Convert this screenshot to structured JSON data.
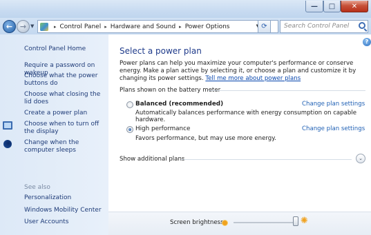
{
  "window": {
    "minimize_label": "—",
    "maximize_label": "□",
    "close_label": "✕"
  },
  "nav": {
    "back_label": "←",
    "forward_label": "→",
    "breadcrumb": [
      "Control Panel",
      "Hardware and Sound",
      "Power Options"
    ],
    "separator": "▸",
    "refresh_glyph": "⟳",
    "search_placeholder": "Search Control Panel"
  },
  "sidebar": {
    "home": "Control Panel Home",
    "items": [
      {
        "label": "Require a password on wakeup"
      },
      {
        "label": "Choose what the power buttons do"
      },
      {
        "label": "Choose what closing the lid does"
      },
      {
        "label": "Create a power plan"
      },
      {
        "label": "Choose when to turn off the display",
        "icon": "monitor-icon"
      },
      {
        "label": "Change when the computer sleeps",
        "icon": "moon-icon"
      }
    ],
    "see_also": "See also",
    "see_also_items": [
      "Personalization",
      "Windows Mobility Center",
      "User Accounts"
    ]
  },
  "main": {
    "help_glyph": "?",
    "title": "Select a power plan",
    "intro_text": "Power plans can help you maximize your computer's performance or conserve energy. Make a plan active by selecting it, or choose a plan and customize it by changing its power settings. ",
    "intro_link": "Tell me more about power plans",
    "group_label": "Plans shown on the battery meter",
    "plans": [
      {
        "name": "Balanced (recommended)",
        "description": "Automatically balances performance with energy consumption on capable hardware.",
        "link": "Change plan settings",
        "selected": false
      },
      {
        "name": "High performance",
        "description": "Favors performance, but may use more energy.",
        "link": "Change plan settings",
        "selected": true
      }
    ],
    "additional_plans": "Show additional plans",
    "expand_glyph": "⌄"
  },
  "brightness": {
    "label": "Screen brightness:",
    "level_percent": 100,
    "sun_glyph": "✺"
  },
  "colors": {
    "link": "#1e5fb4",
    "title": "#1e3a8a",
    "sidebar_text": "#1d3a77"
  }
}
